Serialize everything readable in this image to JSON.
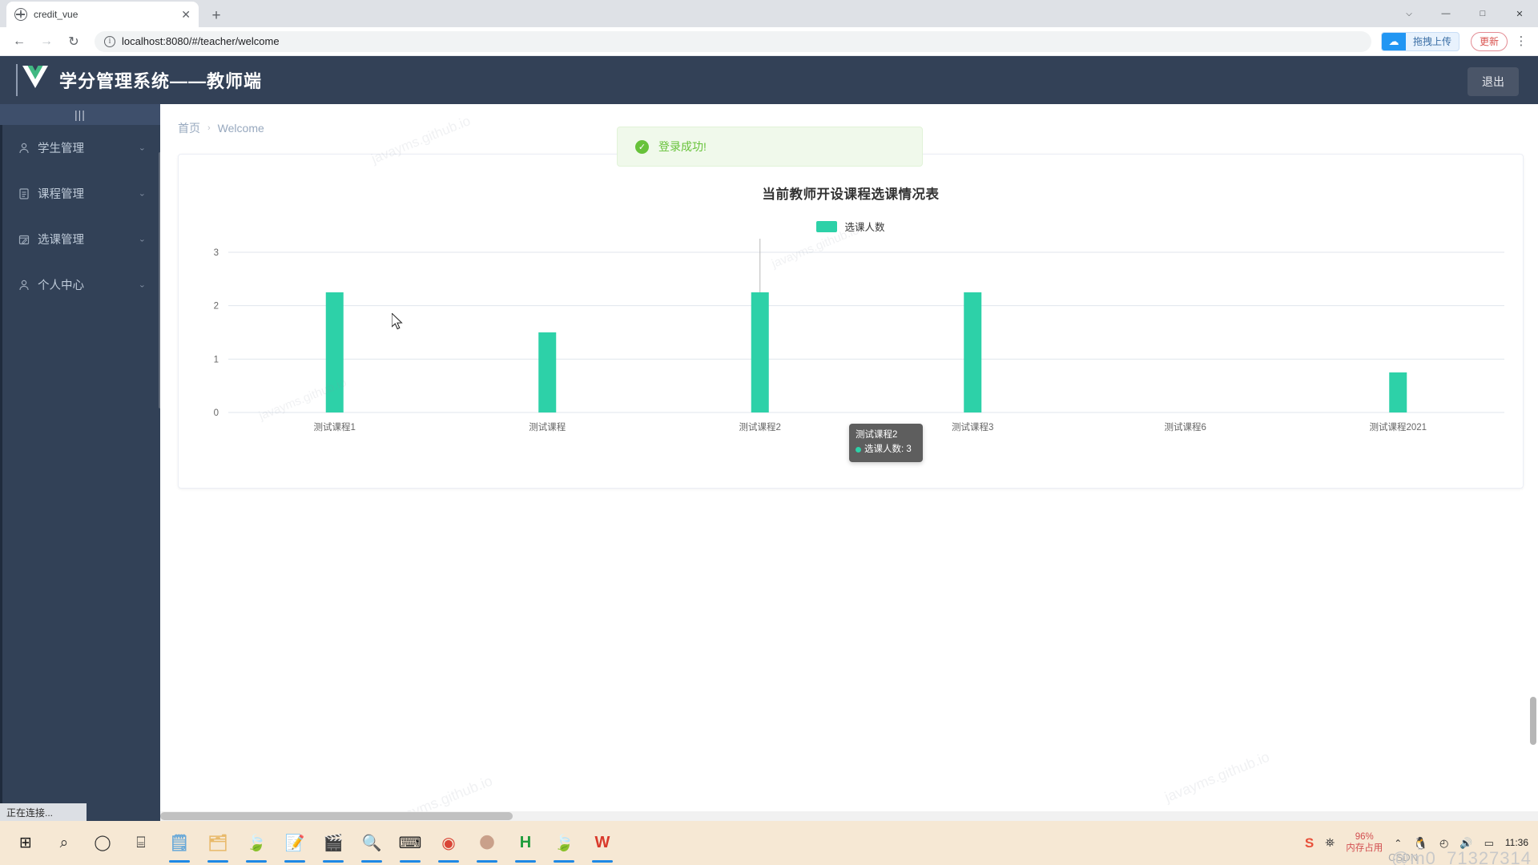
{
  "browser": {
    "tab": {
      "title": "credit_vue",
      "favicon": "globe-icon",
      "close": "✕"
    },
    "new_tab": "+",
    "window_controls": {
      "minimize": "—",
      "maximize": "□",
      "close": "✕",
      "chevron": "⌵"
    },
    "nav": {
      "back": "←",
      "forward": "→",
      "reload": "↻"
    },
    "omnibox": {
      "url": "localhost:8080/#/teacher/welcome",
      "info": "i"
    },
    "extension_pill": {
      "label": "拖拽上传"
    },
    "update_button": "更新",
    "menu": "⋮"
  },
  "app": {
    "title": "学分管理系统——教师端",
    "logout_label": "退出",
    "header_bg": "#334157",
    "sidebar_bg": "#324157"
  },
  "sidebar": {
    "collapse_label": "|||",
    "items": [
      {
        "label": "学生管理",
        "icon": "user-icon",
        "chevron": "⌄"
      },
      {
        "label": "课程管理",
        "icon": "clipboard-icon",
        "chevron": "⌄"
      },
      {
        "label": "选课管理",
        "icon": "calendar-edit-icon",
        "chevron": "⌄"
      },
      {
        "label": "个人中心",
        "icon": "user-circle-icon",
        "chevron": "⌄"
      }
    ]
  },
  "breadcrumb": {
    "home": "首页",
    "separator": "›",
    "current": "Welcome"
  },
  "toast": {
    "message": "登录成功!",
    "icon": "✓",
    "color": "#67c23a",
    "bg": "#f0f9eb"
  },
  "tooltip": {
    "category": "测试课程2",
    "series_label": "选课人数",
    "value": "3",
    "text": "选课人数: 3",
    "dot_color": "#2dd1a8"
  },
  "chart_data": {
    "type": "bar",
    "title": "当前教师开设课程选课情况表",
    "xlabel": "",
    "ylabel": "",
    "ylim": [
      0,
      3
    ],
    "yticks": [
      "0",
      "1",
      "2",
      "3"
    ],
    "grid": true,
    "legend_position": "top",
    "series_color": "#2dd1a8",
    "legend": [
      "选课人数"
    ],
    "categories": [
      "测试课程1",
      "测试课程",
      "测试课程2",
      "测试课程3",
      "测试课程6",
      "测试课程2021"
    ],
    "series": [
      {
        "name": "选课人数",
        "values": [
          2.25,
          1.5,
          2.25,
          2.25,
          0,
          0.75
        ]
      }
    ]
  },
  "watermarks": {
    "site": "javayms.github.io",
    "taskbar_user": "@m0_71327314",
    "csdn": "CSDN"
  },
  "status_bar": {
    "text": "正在连接..."
  },
  "taskbar": {
    "start": "start-icon",
    "left_items": [
      {
        "name": "start-button",
        "glyph": "⊞"
      },
      {
        "name": "search-button",
        "glyph": "⌕"
      },
      {
        "name": "cortana-button",
        "glyph": "◯"
      },
      {
        "name": "task-view-button",
        "glyph": "⌸"
      },
      {
        "name": "notepad-app",
        "glyph": "🗒"
      },
      {
        "name": "file-explorer-app",
        "glyph": "🗂"
      },
      {
        "name": "navicat-app",
        "glyph": "🍃"
      },
      {
        "name": "editor-app",
        "glyph": "📝"
      },
      {
        "name": "video-app",
        "glyph": "🎬"
      },
      {
        "name": "everything-app",
        "glyph": "🔍"
      },
      {
        "name": "terminal-app",
        "glyph": "⌨"
      },
      {
        "name": "chrome-app",
        "glyph": "◉"
      },
      {
        "name": "idea-app",
        "glyph": "🌑"
      },
      {
        "name": "hbuilder-app",
        "glyph": "H"
      },
      {
        "name": "spring-app",
        "glyph": "🍃"
      },
      {
        "name": "wps-app",
        "glyph": "W"
      }
    ],
    "tray": {
      "sogou": "S",
      "people": "⛯",
      "memory_percent": "96%",
      "memory_label": "内存占用",
      "chevron": "⌃",
      "qq": "🐧",
      "network": "◴",
      "volume": "🔊",
      "battery": "▭",
      "time": "11:36"
    }
  }
}
